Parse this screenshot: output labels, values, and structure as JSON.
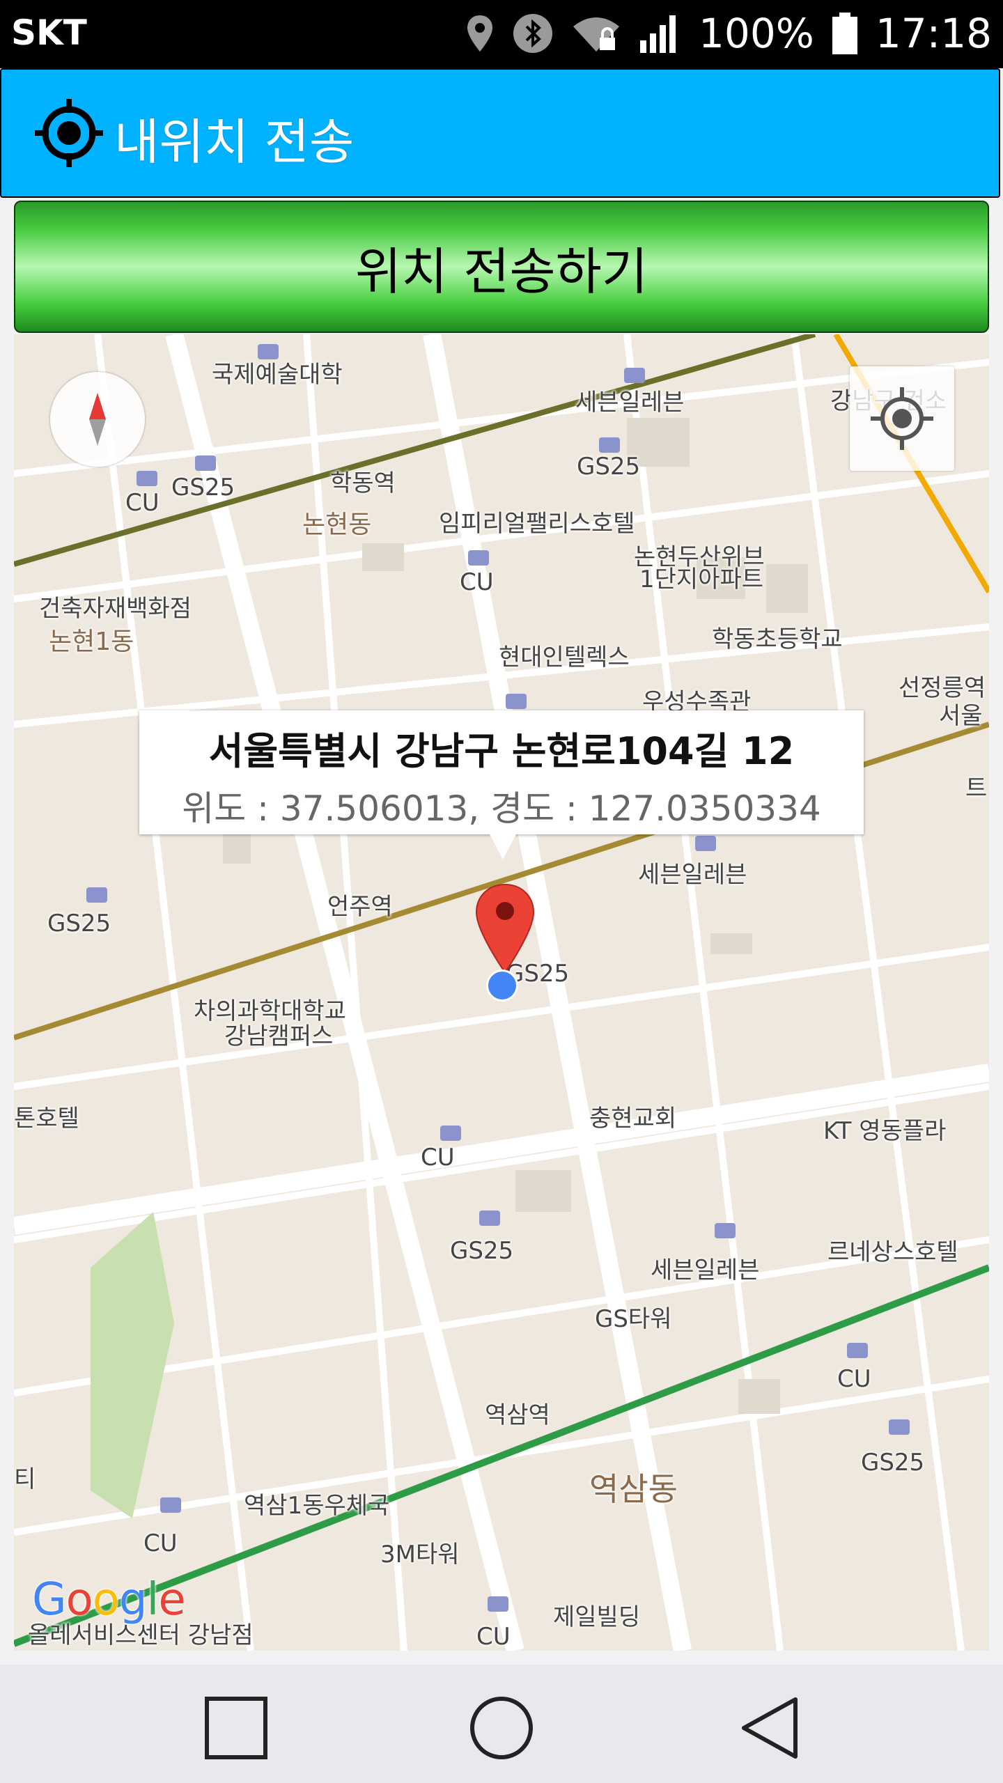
{
  "status_bar": {
    "carrier": "SKT",
    "battery_percent": "100%",
    "time": "17:18",
    "icons": [
      "location-icon",
      "bluetooth-icon",
      "wifi-lock-icon",
      "signal-icon",
      "battery-icon"
    ]
  },
  "title_bar": {
    "title": "내위치 전송",
    "icon": "crosshair-icon"
  },
  "send_button": {
    "label": "위치 전송하기",
    "color_top": "#2b9b2b",
    "color_mid": "#b6f7b0"
  },
  "map": {
    "info_window": {
      "address": "서울특별시 강남구 논현로104길 12",
      "coords": "위도 : 37.506013, 경도 : 127.0350334"
    },
    "labels": {
      "l01": "국제예술대학",
      "l02": "세븐일레븐",
      "l03": "강남구 건소",
      "l04": "학동역",
      "l05": "GS25",
      "l06": "GS25",
      "l07": "CU",
      "l08": "논현동",
      "l09": "임피리얼팰리스호텔",
      "l10": "논현두산위브",
      "l11": "1단지아파트",
      "l12": "CU",
      "l13": "건축자재백화점",
      "l14": "논현1동",
      "l15": "학동초등학교",
      "l16": "현대인텔렉스",
      "l17": "선정릉역",
      "l18": "서울",
      "l19": "우성수족관",
      "l20": "세븐일레븐",
      "l21": "언주역",
      "l22": "GS25",
      "l23": "GS25",
      "l24": "차의과학대학교",
      "l25": "강남캠퍼스",
      "l26": "충현교회",
      "l27": "KT 영동플라",
      "l28": "톤호텔",
      "l29": "CU",
      "l30": "GS25",
      "l31": "세븐일레븐",
      "l32": "르네상스호텔",
      "l33": "GS타워",
      "l34": "CU",
      "l35": "역삼역",
      "l36": "GS25",
      "l37": "역삼동",
      "l38": "역삼1동우체국",
      "l39": "3M타워",
      "l40": "CU",
      "l41": "제일빌딩",
      "l42": "올레서비스센터 강남점",
      "l43": "CU",
      "l44": "티",
      "l45": "트"
    },
    "google_logo": {
      "G": "G",
      "o1": "o",
      "o2": "o",
      "g": "g",
      "l": "l",
      "e": "e"
    },
    "colors": {
      "background": "#efe8de",
      "road": "#ffffff",
      "line_2_green": "#2e9b47",
      "line_9_gold": "#a38a33",
      "line_bundang": "#f2a900",
      "line_7_olive": "#6a6f2a",
      "marker_red": "#ea4335",
      "blue_dot": "#4285f4"
    }
  },
  "nav_bar": {
    "buttons": [
      "recents-square-icon",
      "home-circle-icon",
      "back-triangle-icon"
    ]
  }
}
